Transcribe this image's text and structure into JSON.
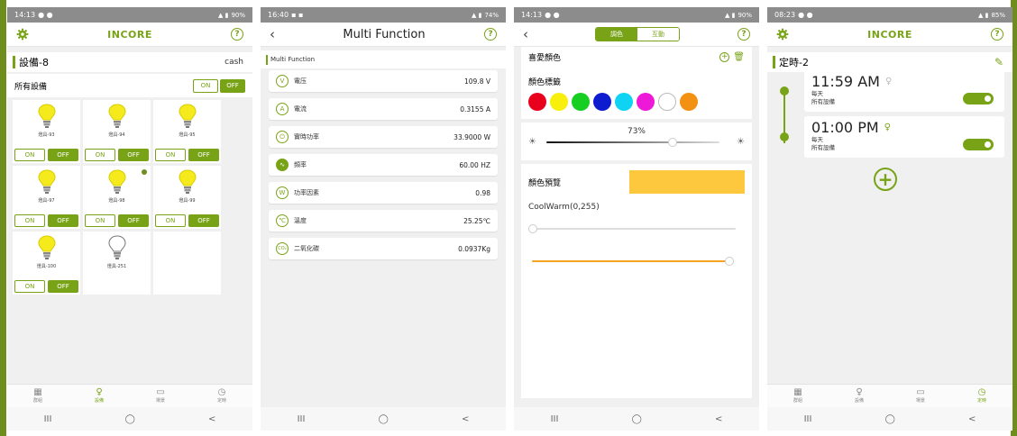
{
  "colors": {
    "green": "#79a317",
    "olive": "#6e8d1c",
    "status_bar": "#8c8c8c",
    "bulb_yellow": "#f5eb1c",
    "orange": "#f4a325",
    "preview": "#fdc83d"
  },
  "phone1": {
    "status": {
      "time": "14:13",
      "right": "90%"
    },
    "header": {
      "logo": "INCORE",
      "help": "?"
    },
    "section": {
      "title": "設備-8",
      "right": "cash"
    },
    "all_devices": {
      "label": "所有設備",
      "on": "ON",
      "off": "OFF"
    },
    "devices": [
      {
        "name": "燈具-93",
        "lit": true,
        "dot": false
      },
      {
        "name": "燈具-94",
        "lit": true,
        "dot": false
      },
      {
        "name": "燈具-95",
        "lit": true,
        "dot": false
      },
      {
        "name": "燈具-97",
        "lit": true,
        "dot": false
      },
      {
        "name": "燈具-98",
        "lit": true,
        "dot": true
      },
      {
        "name": "燈具-99",
        "lit": true,
        "dot": false
      },
      {
        "name": "燈具-100",
        "lit": true,
        "dot": false
      },
      {
        "name": "燈具-251",
        "lit": false,
        "dot": false
      }
    ],
    "on_label": "ON",
    "off_label": "OFF",
    "tabs": [
      {
        "label": "群組",
        "icon": "group-icon",
        "active": false
      },
      {
        "label": "設備",
        "icon": "bulb-icon",
        "active": true
      },
      {
        "label": "場景",
        "icon": "scene-icon",
        "active": false
      },
      {
        "label": "定時",
        "icon": "clock-icon",
        "active": false
      }
    ]
  },
  "phone2": {
    "status": {
      "time": "16:40",
      "right": "74%"
    },
    "header": {
      "title": "Multi Function",
      "help": "?"
    },
    "section_label": "Multi Function",
    "rows": [
      {
        "icon": "V",
        "label": "電压",
        "value": "109.8 V"
      },
      {
        "icon": "A",
        "label": "電流",
        "value": "0.3155 A"
      },
      {
        "icon": "⏻",
        "label": "實時功率",
        "value": "33.9000 W"
      },
      {
        "icon": "∿",
        "label": "頻率",
        "value": "60.00 HZ"
      },
      {
        "icon": "W",
        "label": "功率因素",
        "value": "0.98"
      },
      {
        "icon": "℃",
        "label": "溫度",
        "value": "25.25℃"
      },
      {
        "icon": "CO₂",
        "label": "二氧化碳",
        "value": "0.0937Kg"
      }
    ]
  },
  "phone3": {
    "status": {
      "time": "14:13",
      "right": "90%"
    },
    "tabs": {
      "active": "調色",
      "inactive": "互動"
    },
    "help": "?",
    "favorites_label": "喜愛顏色",
    "color_label": "顏色標籤",
    "swatches": [
      "#e8001d",
      "#f9ef0d",
      "#16cf22",
      "#0d1ccf",
      "#0fd3f3",
      "#ee18d8",
      "#ffffff",
      "#f29112"
    ],
    "brightness": {
      "percent_text": "73%",
      "value": 0.73
    },
    "preview_label": "顏色預覽",
    "coolwarm_label": "CoolWarm(0,255)",
    "coolwarm_value": 0,
    "second_slider_value": 1.0
  },
  "phone4": {
    "status": {
      "time": "08:23",
      "right": "85%"
    },
    "header": {
      "logo": "INCORE",
      "help": "?"
    },
    "section_title": "定時-2",
    "schedules": [
      {
        "time": "11:59 AM",
        "repeat": "每天",
        "target": "所有設備",
        "enabled": true
      },
      {
        "time": "01:00 PM",
        "repeat": "每天",
        "target": "所有設備",
        "enabled": true
      }
    ],
    "tabs": [
      {
        "label": "群組",
        "icon": "group-icon",
        "active": false
      },
      {
        "label": "設備",
        "icon": "bulb-icon",
        "active": false
      },
      {
        "label": "場景",
        "icon": "scene-icon",
        "active": false
      },
      {
        "label": "定時",
        "icon": "clock-icon",
        "active": true
      }
    ]
  },
  "nav": {
    "recent": "III",
    "home": "◯",
    "back": "<"
  }
}
